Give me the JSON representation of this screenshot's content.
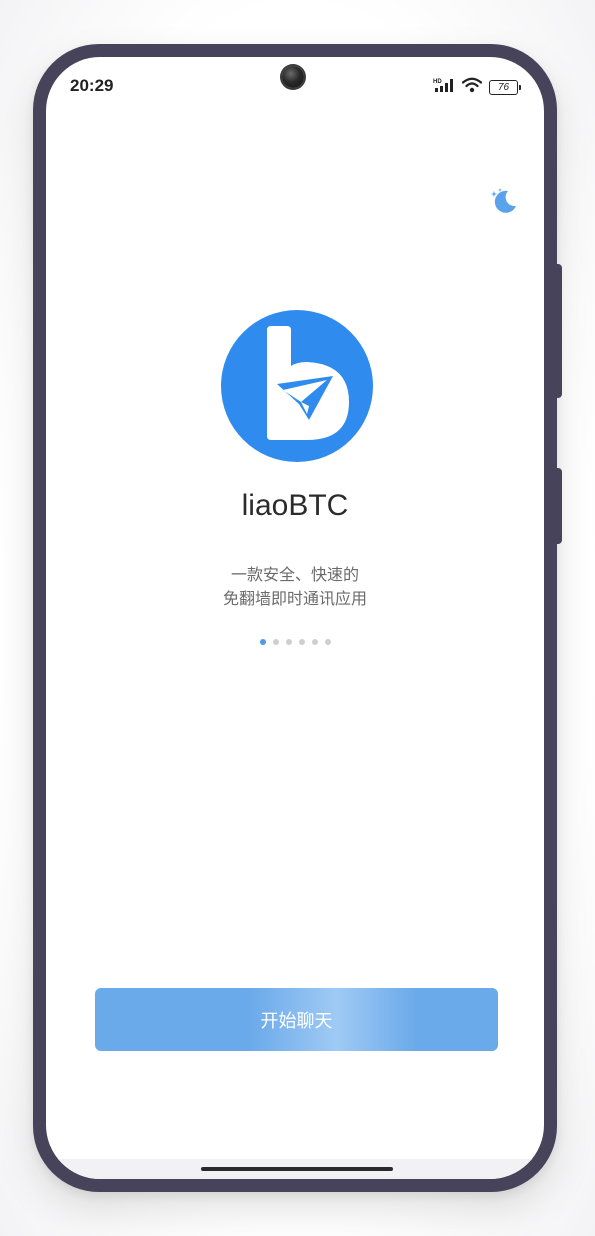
{
  "status_bar": {
    "time": "20:29",
    "network_badge": "HD",
    "battery_level": "76",
    "icons": [
      "signal-icon",
      "wifi-icon",
      "battery-icon"
    ]
  },
  "theme_toggle": {
    "icon": "moon-icon"
  },
  "app": {
    "name": "liaoBTC",
    "tagline_line1": "一款安全、快速的",
    "tagline_line2": "免翻墙即时通讯应用",
    "logo_icon": "liaobtc-logo-icon"
  },
  "pager": {
    "total": 6,
    "active_index": 0
  },
  "start_button": {
    "label": "开始聊天"
  },
  "colors": {
    "accent": "#2f8cee",
    "button": "#6aa9ea",
    "dot_active": "#4f9ae0",
    "dot_inactive": "#cfcfcf",
    "frame": "#46435a"
  }
}
